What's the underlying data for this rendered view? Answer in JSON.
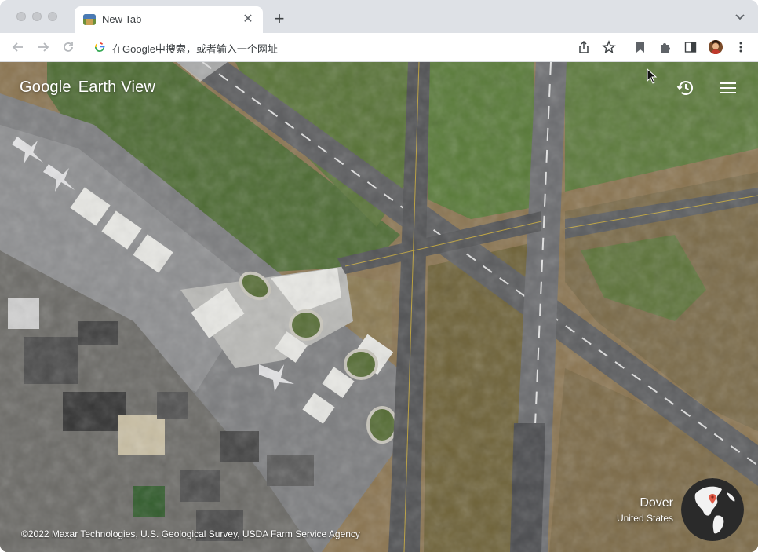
{
  "browser": {
    "tab": {
      "title": "New Tab",
      "favicon": "earth-view-favicon",
      "close_icon": "close-icon"
    },
    "new_tab_icon": "plus-icon",
    "tab_list_icon": "chevron-down-icon",
    "omnibox": {
      "placeholder": "在Google中搜索，或者输入一个网址",
      "icon": "google-g-icon"
    },
    "toolbar_icons": [
      "back-icon",
      "forward-icon",
      "reload-icon",
      "share-icon",
      "star-icon",
      "bookmark-icon",
      "extensions-icon",
      "side-panel-icon",
      "avatar",
      "more-vert-icon"
    ]
  },
  "earth_view": {
    "brand_google": "Google",
    "brand_product": "Earth View",
    "history_icon": "history-icon",
    "menu_icon": "menu-icon",
    "location": {
      "city": "Dover",
      "country": "United States"
    },
    "globe_icon": "globe-icon",
    "attribution": "©2022 Maxar Technologies, U.S. Geological Survey, USDA Farm Service Agency"
  },
  "colors": {
    "accent_marker": "#e05a47",
    "tab_strip": "#dee1e6",
    "toolbar": "#ffffff"
  }
}
